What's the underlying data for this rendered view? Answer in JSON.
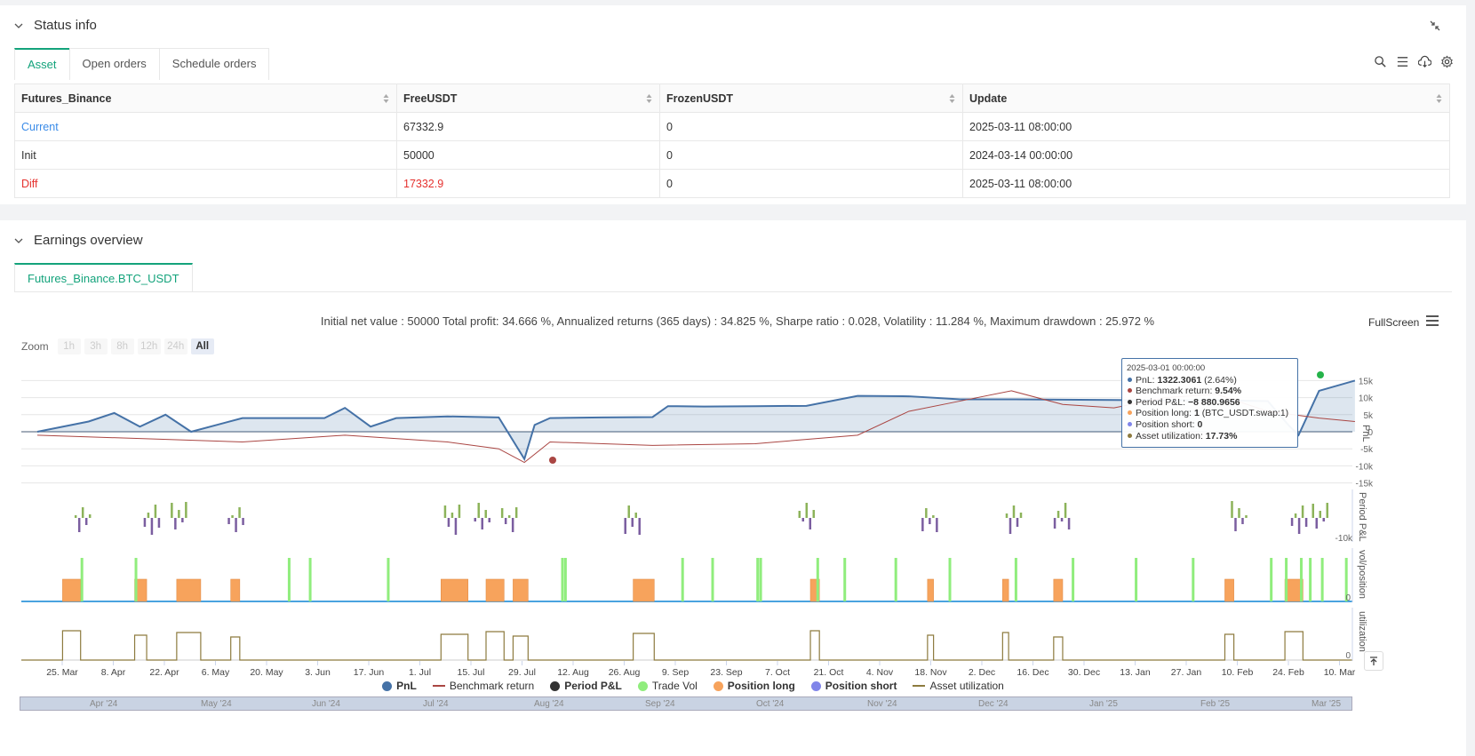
{
  "status": {
    "title": "Status info",
    "tabs": [
      "Asset",
      "Open orders",
      "Schedule orders"
    ],
    "table": {
      "headers": [
        "Futures_Binance",
        "FreeUSDT",
        "FrozenUSDT",
        "Update"
      ],
      "rows": [
        {
          "label": "Current",
          "free": "67332.9",
          "frozen": "0",
          "update": "2025-03-11 08:00:00"
        },
        {
          "label": "Init",
          "free": "50000",
          "frozen": "0",
          "update": "2024-03-14 00:00:00"
        },
        {
          "label": "Diff",
          "free": "17332.9",
          "frozen": "0",
          "update": "2025-03-11 08:00:00"
        }
      ]
    }
  },
  "earnings": {
    "title": "Earnings overview",
    "tab": "Futures_Binance.BTC_USDT",
    "summary": "Initial net value : 50000 Total profit: 34.666 %, Annualized returns (365 days) : 34.825 %, Sharpe ratio : 0.028, Volatility : 11.284 %, Maximum drawdown : 25.972 %",
    "fullscreen": "FullScreen",
    "zoom_label": "Zoom",
    "zoom_buttons": [
      "1h",
      "3h",
      "8h",
      "12h",
      "24h",
      "All"
    ],
    "tooltip": {
      "time": "2025-03-01 00:00:00",
      "pnl_label": "PnL:",
      "pnl_value": "1322.3061",
      "pnl_pct": "(2.64%)",
      "bench_label": "Benchmark return:",
      "bench_value": "9.54%",
      "period_label": "Period P&L:",
      "period_value": "−8 880.9656",
      "long_label": "Position long:",
      "long_value": "1",
      "long_extra": "(BTC_USDT.swap:1)",
      "short_label": "Position short:",
      "short_value": "0",
      "util_label": "Asset utilization:",
      "util_value": "17.73%"
    },
    "legend": [
      "PnL",
      "Benchmark return",
      "Period P&L",
      "Trade Vol",
      "Position long",
      "Position short",
      "Asset utilization"
    ],
    "navigator_labels": [
      "Apr '24",
      "May '24",
      "Jun '24",
      "Jul '24",
      "Aug '24",
      "Sep '24",
      "Oct '24",
      "Nov '24",
      "Dec '24",
      "Jan '25",
      "Feb '25",
      "Mar '25"
    ]
  },
  "colors": {
    "pnl": "#4572a7",
    "benchmark": "#aa4643",
    "period": "#333333",
    "trade_vol": "#90ed7d",
    "position_long": "#f7a35c",
    "position_short": "#8085e9",
    "asset_util": "#8d7b3f",
    "accent": "#13a37b"
  },
  "chart_data": {
    "type": "line",
    "x_tick_labels": [
      "25. Mar",
      "8. Apr",
      "22. Apr",
      "6. May",
      "20. May",
      "3. Jun",
      "17. Jun",
      "1. Jul",
      "15. Jul",
      "29. Jul",
      "12. Aug",
      "26. Aug",
      "9. Sep",
      "23. Sep",
      "7. Oct",
      "21. Oct",
      "4. Nov",
      "18. Nov",
      "2. Dec",
      "16. Dec",
      "30. Dec",
      "13. Jan",
      "27. Jan",
      "10. Feb",
      "24. Feb",
      "10. Mar"
    ],
    "pnl_axis": {
      "label": "PnL",
      "ticks": [
        "15k",
        "10k",
        "5k",
        "0",
        "-5k",
        "-10k",
        "-15k"
      ],
      "values": [
        15000,
        10000,
        5000,
        0,
        -5000,
        -10000,
        -15000
      ]
    },
    "period_axis": {
      "label": "Period P&L",
      "ticks": [
        "-10k"
      ]
    },
    "vol_axis": {
      "label": "vol/position",
      "ticks": [
        "0"
      ]
    },
    "util_axis": {
      "label": "utilization",
      "ticks": [
        "0"
      ]
    },
    "series": [
      {
        "name": "PnL",
        "x_index": [
          0,
          1,
          1.5,
          2,
          2.5,
          3,
          4,
          5,
          5.6,
          6,
          6.5,
          7,
          8,
          9,
          9.5,
          9.7,
          10,
          11,
          12,
          12.3,
          13,
          14,
          15,
          16,
          17,
          18,
          19,
          20,
          21,
          22,
          23,
          24,
          24.4,
          24.6,
          25,
          25.7
        ],
        "values": [
          0,
          3000,
          5500,
          1500,
          5000,
          0,
          4000,
          4000,
          4000,
          7000,
          1500,
          4000,
          4500,
          4200,
          -8000,
          2000,
          4000,
          4200,
          4300,
          7500,
          7400,
          7500,
          7600,
          10500,
          10400,
          9500,
          9500,
          9400,
          9300,
          9200,
          9200,
          9000,
          2000,
          -1000,
          12000,
          15000
        ]
      },
      {
        "name": "Benchmark return",
        "x_index": [
          0,
          2,
          4,
          6,
          8,
          9,
          9.5,
          10,
          12,
          14,
          16,
          17,
          18,
          19,
          20,
          21,
          22,
          23,
          24,
          25,
          25.7
        ],
        "values": [
          -1000,
          -2000,
          -3000,
          -1000,
          -3000,
          -5000,
          -9000,
          -3000,
          -4000,
          -3500,
          -1000,
          6000,
          9000,
          12000,
          8000,
          7000,
          10000,
          11000,
          6000,
          4000,
          3000
        ]
      }
    ],
    "position_long_spans": [
      [
        0.9,
        1.5
      ],
      [
        3.3,
        3.7
      ],
      [
        4.7,
        5.5
      ],
      [
        6.5,
        6.8
      ],
      [
        13.5,
        14.4
      ],
      [
        15.0,
        15.6
      ],
      [
        15.9,
        16.4
      ],
      [
        19.9,
        20.6
      ],
      [
        25.8,
        26.1
      ],
      [
        29.7,
        29.9
      ],
      [
        32.2,
        32.4
      ],
      [
        33.9,
        34.2
      ],
      [
        39.6,
        39.9
      ],
      [
        41.6,
        42.2
      ]
    ],
    "trade_vol_x": [
      1.5,
      3.3,
      8.4,
      9.1,
      11.7,
      17.5,
      17.6,
      21.5,
      22.5,
      24.0,
      24.1,
      26.0,
      26.9,
      28.6,
      30.4,
      32.6,
      34.5,
      36.6,
      38.5,
      41.1,
      41.6,
      42.1,
      42.4,
      42.8,
      43.6
    ]
  }
}
